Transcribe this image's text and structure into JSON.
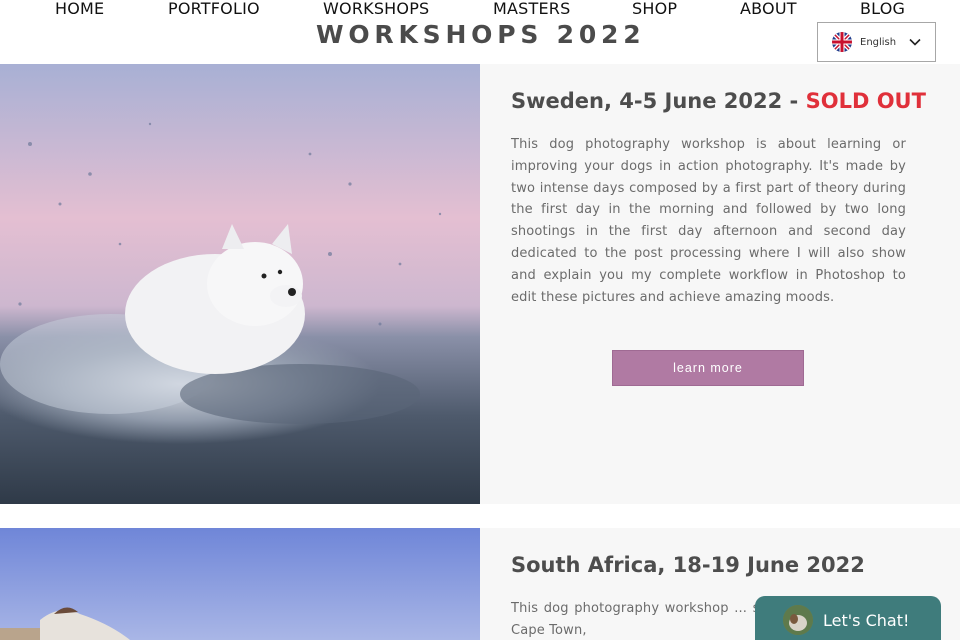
{
  "nav": {
    "items": [
      {
        "label": "HOME"
      },
      {
        "label": "PORTFOLIO"
      },
      {
        "label": "WORKSHOPS"
      },
      {
        "label": "MASTERS"
      },
      {
        "label": "SHOP"
      },
      {
        "label": "ABOUT"
      },
      {
        "label": "BLOG"
      }
    ]
  },
  "page_title": "WORKSHOPS 2022",
  "language": {
    "selected": "English",
    "flag_icon": "uk-flag-icon"
  },
  "workshops": [
    {
      "title": "Sweden, 4-5 June 2022 - ",
      "status": "SOLD OUT",
      "description": "This dog photography workshop is about learning or improving your dogs in action photography. It's made by two intense days composed by a first part of theory during the first day in the morning and followed by two long shootings in the first day afternoon and second day dedicated to the post processing where I will also show and explain you my complete workflow in Photoshop to edit these pictures and achieve amazing moods.",
      "button_label": "learn more"
    },
    {
      "title": "South Africa, 18-19 June 2022",
      "description": "This dog photography workshop ... spectacular location in Cape Town,"
    }
  ],
  "chat": {
    "label": "Let's Chat!"
  },
  "colors": {
    "sold_out": "#e0303a",
    "button": "#b07aa3",
    "chat": "#3f7c7c"
  }
}
